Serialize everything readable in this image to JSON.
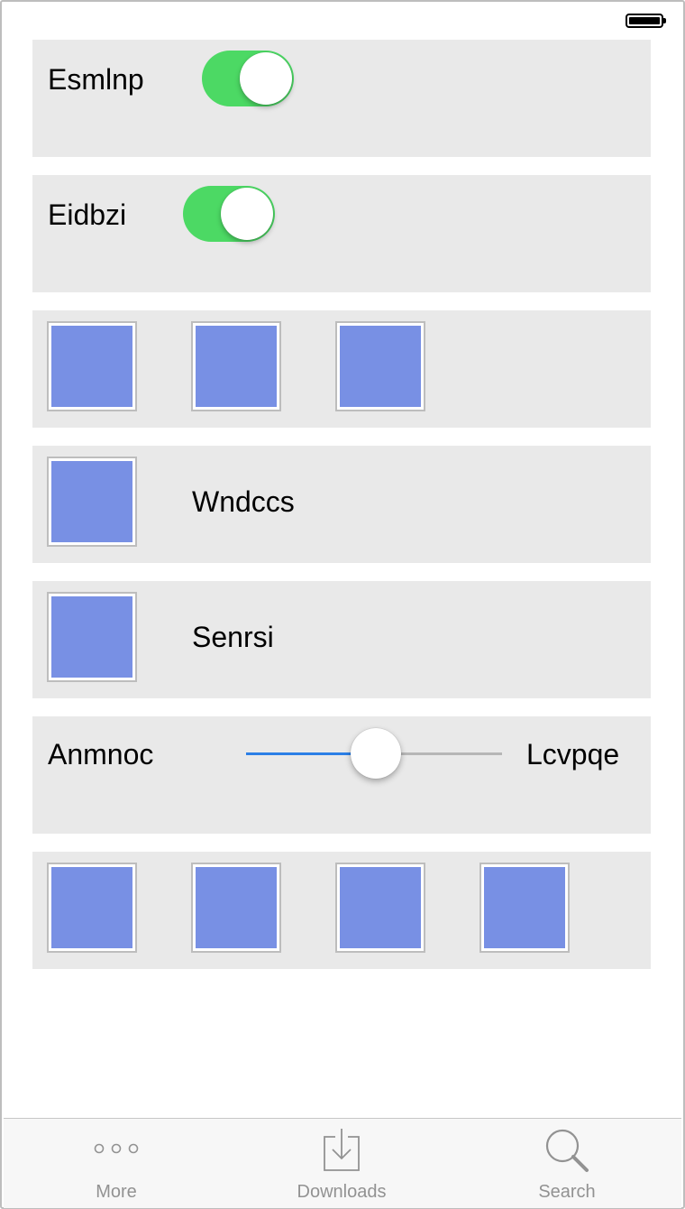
{
  "status_bar": {
    "battery": "full"
  },
  "rows": {
    "toggle1": {
      "label": "Esmlnp",
      "on": true
    },
    "toggle2": {
      "label": "Eidbzi",
      "on": true
    },
    "image_row_1": {
      "count": 3
    },
    "image_label_1": {
      "label": "Wndccs"
    },
    "image_label_2": {
      "label": "Senrsi"
    },
    "slider": {
      "min_label": "Anmnoc",
      "max_label": "Lcvpqe",
      "value": 0.5
    },
    "image_row_2": {
      "count": 4
    }
  },
  "tabbar": {
    "items": [
      {
        "label": "More",
        "icon": "more-icon"
      },
      {
        "label": "Downloads",
        "icon": "downloads-icon"
      },
      {
        "label": "Search",
        "icon": "search-icon"
      }
    ]
  },
  "colors": {
    "toggle_on": "#4cd964",
    "slider_min_track": "#2b7fe6",
    "slider_max_track": "#b6b6b6",
    "image_fill": "#7890e4",
    "row_background": "#e9e9e9",
    "tab_label": "#929292"
  }
}
